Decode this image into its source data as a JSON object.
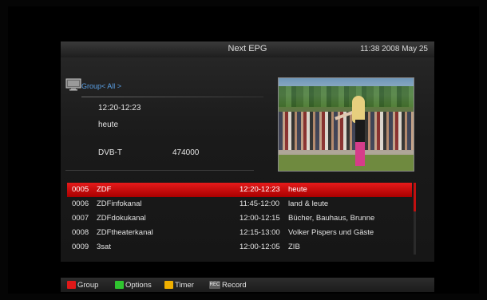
{
  "header": {
    "title": "Next EPG",
    "datetime": "11:38 2008 May 25"
  },
  "info": {
    "group_label": "Group< All >",
    "time": "12:20-12:23",
    "program": "heute",
    "network": "DVB-T",
    "frequency": "474000"
  },
  "channels": [
    {
      "num": "0005",
      "name": "ZDF",
      "time": "12:20-12:23",
      "program": "heute",
      "selected": true
    },
    {
      "num": "0006",
      "name": "ZDFinfokanal",
      "time": "11:45-12:00",
      "program": "land & leute"
    },
    {
      "num": "0007",
      "name": "ZDFdokukanal",
      "time": "12:00-12:15",
      "program": "Bücher, Bauhaus, Brunne"
    },
    {
      "num": "0008",
      "name": "ZDFtheaterkanal",
      "time": "12:15-13:00",
      "program": "Volker Pispers und Gäste"
    },
    {
      "num": "0009",
      "name": "3sat",
      "time": "12:00-12:05",
      "program": "ZIB"
    }
  ],
  "footer": {
    "keys": [
      {
        "label": "Group",
        "color": "#e01818"
      },
      {
        "label": "Options",
        "color": "#2fc42f"
      },
      {
        "label": "Timer",
        "color": "#f0b000"
      },
      {
        "label": "Record",
        "badge": "REC"
      }
    ]
  },
  "colors": {
    "highlight": "#d40000",
    "group_text": "#5aa0e6"
  },
  "icons": [
    "tv-icon",
    "preview-video",
    "rec-icon"
  ]
}
